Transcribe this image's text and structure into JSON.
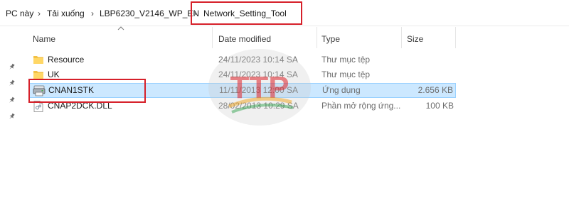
{
  "breadcrumb": {
    "items": [
      "PC này",
      "Tải xuống",
      "LBP6230_V2146_WP_EN",
      "Network_Setting_Tool"
    ],
    "separator": "›"
  },
  "columns": {
    "name": "Name",
    "date_modified": "Date modified",
    "type": "Type",
    "size": "Size"
  },
  "files": [
    {
      "name": "Resource",
      "date": "24/11/2023 10:14 SA",
      "type": "Thư mục tệp",
      "size": "",
      "icon": "folder-icon"
    },
    {
      "name": "UK",
      "date": "24/11/2023 10:14 SA",
      "type": "Thư mục tệp",
      "size": "",
      "icon": "folder-icon"
    },
    {
      "name": "CNAN1STK",
      "date": "11/11/2013 12:00 SA",
      "type": "Ứng dụng",
      "size": "2.656 KB",
      "icon": "application-icon",
      "selected": true
    },
    {
      "name": "CNAP2DCK.DLL",
      "date": "28/02/2013 10:29 SA",
      "type": "Phần mở rộng ứng...",
      "size": "100 KB",
      "icon": "dll-file-icon"
    }
  ],
  "watermark": {
    "text": "TTP"
  },
  "colors": {
    "highlight_box": "#d6202a",
    "selection_bg": "#cce8ff",
    "selection_border": "#99d1ff",
    "folder": "#f3c144"
  }
}
